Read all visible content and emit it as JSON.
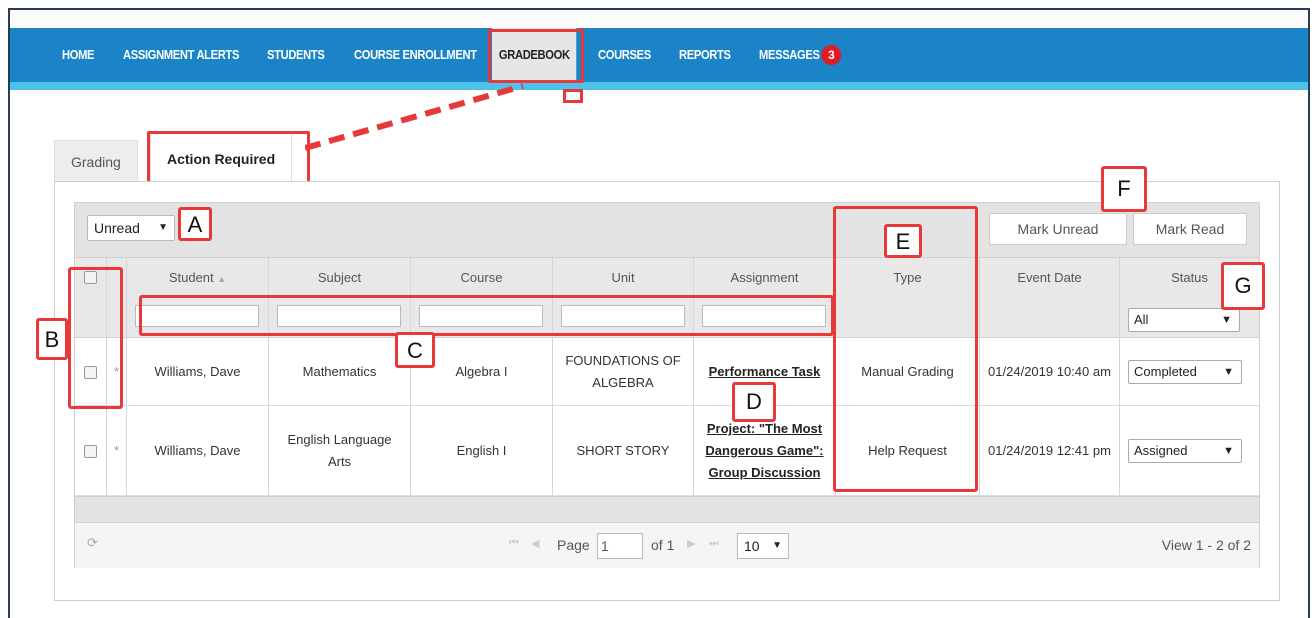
{
  "nav": {
    "items": [
      {
        "label": "HOME"
      },
      {
        "label": "ASSIGNMENT ALERTS"
      },
      {
        "label": "STUDENTS"
      },
      {
        "label": "COURSE ENROLLMENT"
      },
      {
        "label": "GRADEBOOK"
      },
      {
        "label": "COURSES"
      },
      {
        "label": "REPORTS"
      },
      {
        "label": "MESSAGES"
      }
    ],
    "messages_count": "3",
    "active": "GRADEBOOK"
  },
  "tabs": {
    "grading": "Grading",
    "action_required": "Action Required"
  },
  "toolbar": {
    "filter_value": "Unread",
    "mark_unread": "Mark Unread",
    "mark_read": "Mark Read"
  },
  "table": {
    "columns": [
      "Student",
      "Subject",
      "Course",
      "Unit",
      "Assignment",
      "Type",
      "Event Date",
      "Status"
    ],
    "sort_indicator": "▲",
    "status_filter": "All",
    "rows": [
      {
        "marker": "*",
        "student": "Williams, Dave",
        "subject": "Mathematics",
        "course": "Algebra I",
        "unit_line1": "FOUNDATIONS OF",
        "unit_line2": "ALGEBRA",
        "assignment_line1": "Performance Task",
        "assignment_line2": "",
        "assignment_line3": "",
        "type": "Manual Grading",
        "event_date": "01/24/2019 10:40 am",
        "status": "Completed"
      },
      {
        "marker": "*",
        "student": "Williams, Dave",
        "subject_line1": "English Language",
        "subject_line2": "Arts",
        "course": "English I",
        "unit": "SHORT STORY",
        "assignment_line1": "Project: \"The Most",
        "assignment_line2": "Dangerous Game\":",
        "assignment_line3": "Group Discussion",
        "type": "Help Request",
        "event_date": "01/24/2019 12:41 pm",
        "status": "Assigned"
      }
    ]
  },
  "pager": {
    "page_label": "Page",
    "page_value": "1",
    "of_label": "of 1",
    "page_size": "10",
    "view_text": "View 1 - 2 of 2"
  },
  "callouts": {
    "A": "A",
    "B": "B",
    "C": "C",
    "D": "D",
    "E": "E",
    "F": "F",
    "G": "G"
  },
  "colors": {
    "nav_bg": "#1a84c7",
    "nav_stripe": "#4dc2ea",
    "callout_red": "#e8393a",
    "badge_red": "#e01b24"
  }
}
